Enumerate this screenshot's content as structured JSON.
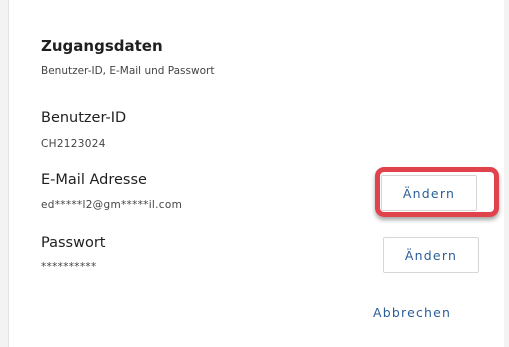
{
  "section": {
    "title": "Zugangsdaten",
    "subtitle": "Benutzer-ID, E-Mail und Passwort"
  },
  "fields": {
    "user_id": {
      "label": "Benutzer-ID",
      "value": "CH2123024"
    },
    "email": {
      "label": "E-Mail Adresse",
      "value": "ed*****l2@gm*****il.com",
      "button": "Ändern"
    },
    "password": {
      "label": "Passwort",
      "value": "**********",
      "button": "Ändern"
    }
  },
  "cancel_label": "Abbrechen",
  "colors": {
    "accent": "#2b5e97",
    "highlight": "#e0434b"
  }
}
